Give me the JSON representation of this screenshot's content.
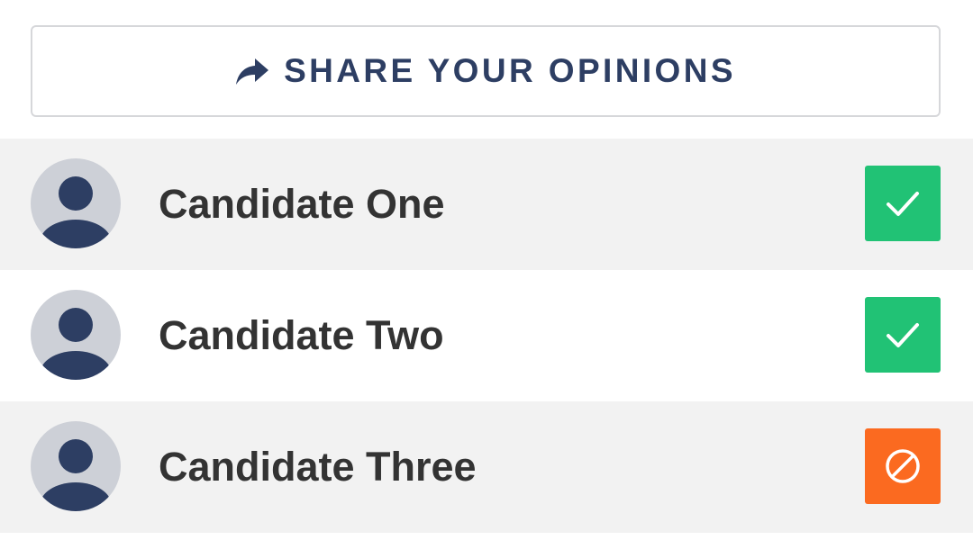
{
  "share": {
    "label": "SHARE YOUR OPINIONS",
    "icon": "share-arrow-icon"
  },
  "candidates": [
    {
      "name": "Candidate One",
      "status": "support",
      "status_icon": "checkmark-icon",
      "status_color": "#21c275"
    },
    {
      "name": "Candidate Two",
      "status": "support",
      "status_icon": "checkmark-icon",
      "status_color": "#21c275"
    },
    {
      "name": "Candidate Three",
      "status": "oppose",
      "status_icon": "prohibited-icon",
      "status_color": "#fb6a20"
    }
  ],
  "colors": {
    "navy": "#2d3e63",
    "row_shade": "#f2f2f2",
    "avatar_bg": "#cdd0d7",
    "name_text": "#333333",
    "border": "#d6d7da"
  }
}
